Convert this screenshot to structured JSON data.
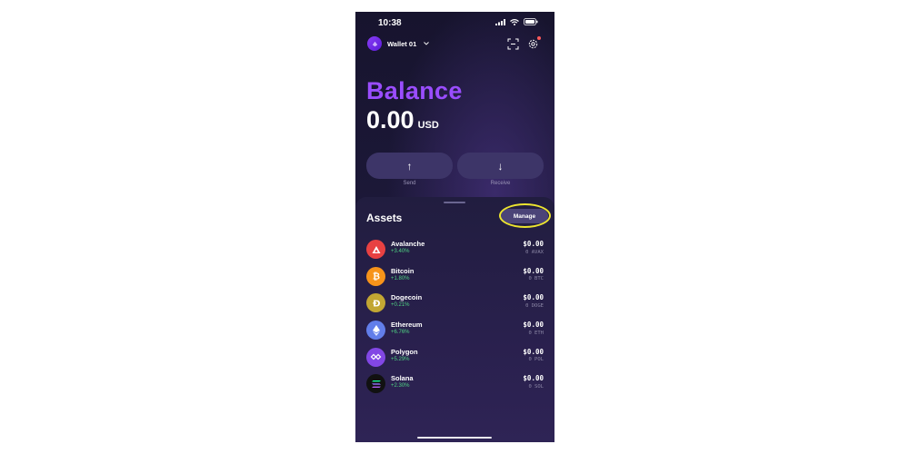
{
  "status_bar": {
    "time": "10:38"
  },
  "header": {
    "wallet_name": "Wallet 01",
    "icons": [
      "wallet-avatar-icon",
      "chevron-down-icon",
      "scan-icon",
      "settings-gear-icon"
    ]
  },
  "balance": {
    "title": "Balance",
    "amount": "0.00",
    "currency": "USD"
  },
  "actions": {
    "send_label": "Send",
    "receive_label": "Receive"
  },
  "assets": {
    "title": "Assets",
    "manage_label": "Manage",
    "items": [
      {
        "name": "Avalanche",
        "change": "+3.40%",
        "value": "$0.00",
        "quantity": "0 AVAX",
        "color": "#e84142",
        "icon": "avalanche-icon"
      },
      {
        "name": "Bitcoin",
        "change": "+1.80%",
        "value": "$0.00",
        "quantity": "0 BTC",
        "color": "#f7931a",
        "icon": "bitcoin-icon"
      },
      {
        "name": "Dogecoin",
        "change": "+0.21%",
        "value": "$0.00",
        "quantity": "0 DOGE",
        "color": "#c2a633",
        "icon": "dogecoin-icon"
      },
      {
        "name": "Ethereum",
        "change": "+6.76%",
        "value": "$0.00",
        "quantity": "0 ETH",
        "color": "#627eea",
        "icon": "ethereum-icon"
      },
      {
        "name": "Polygon",
        "change": "+5.29%",
        "value": "$0.00",
        "quantity": "0 POL",
        "color": "#8247e5",
        "icon": "polygon-icon"
      },
      {
        "name": "Solana",
        "change": "+2.30%",
        "value": "$0.00",
        "quantity": "0 SOL",
        "color": "#111111",
        "icon": "solana-icon"
      }
    ]
  },
  "colors": {
    "accent": "#9a4dff",
    "positive": "#4fd383",
    "highlight": "#ece42f"
  }
}
